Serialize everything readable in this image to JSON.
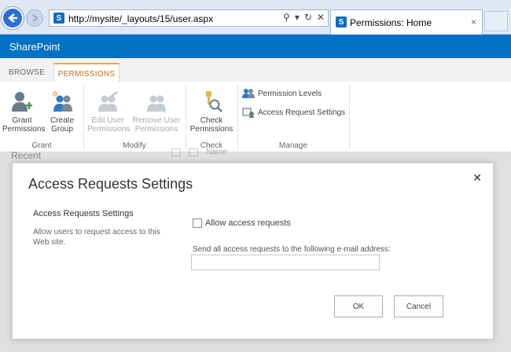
{
  "browser": {
    "url": "http://mysite/_layouts/15/user.aspx",
    "tab_title": "Permissions: Home",
    "tab_close": "×",
    "url_icons": [
      "⚲",
      "▾",
      "↻",
      "✕"
    ]
  },
  "sharepoint": {
    "brand": "SharePoint",
    "logo_letter": "S"
  },
  "ribbon": {
    "tabs": [
      "BROWSE",
      "PERMISSIONS"
    ],
    "active_tab": "PERMISSIONS",
    "groups": {
      "grant": {
        "label": "Grant",
        "buttons": [
          {
            "line1": "Grant",
            "line2": "Permissions"
          },
          {
            "line1": "Create",
            "line2": "Group"
          }
        ]
      },
      "modify": {
        "label": "Modify",
        "buttons": [
          {
            "line1": "Edit User",
            "line2": "Permissions"
          },
          {
            "line1": "Remove User",
            "line2": "Permissions"
          }
        ]
      },
      "check": {
        "label": "Check",
        "buttons": [
          {
            "line1": "Check",
            "line2": "Permissions"
          }
        ]
      },
      "manage": {
        "label": "Manage",
        "items": [
          "Permission Levels",
          "Access Request Settings"
        ]
      }
    }
  },
  "background": {
    "recent": "Recent",
    "name_column": "Name"
  },
  "dialog": {
    "title": "Access Requests Settings",
    "close": "✕",
    "section_title": "Access Requests Settings",
    "section_description": "Allow users to request access to this Web site.",
    "checkbox_label": "Allow access requests",
    "checkbox_checked": false,
    "email_label": "Send all access requests to the following e-mail address:",
    "email_value": "",
    "ok_label": "OK",
    "cancel_label": "Cancel"
  },
  "colors": {
    "brand_blue": "#0072c6",
    "active_tab_accent": "#c56a1f",
    "browser_chrome": "#dfe9f5"
  }
}
